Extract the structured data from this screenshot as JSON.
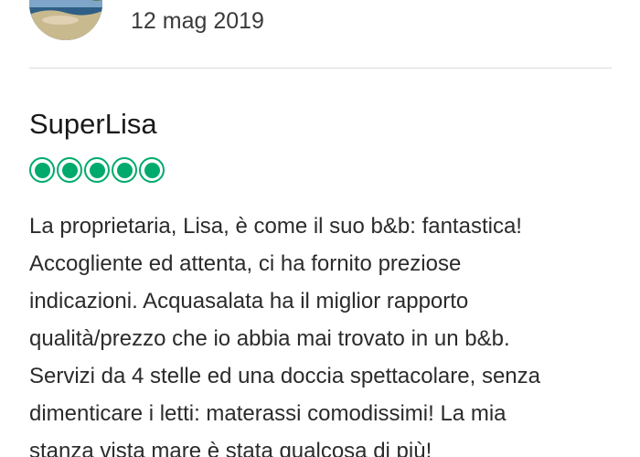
{
  "previous_review": {
    "date": "12 mag 2019",
    "avatar_icon": "profile-photo-beach"
  },
  "review": {
    "reviewer": "SuperLisa",
    "rating": {
      "value": 5,
      "max": 5,
      "icon": "rating-bubble",
      "color": "#00aa6c"
    },
    "text_lines": [
      "La proprietaria, Lisa, è come il suo b&b: fantastica!",
      "Accogliente ed attenta, ci ha fornito preziose",
      "indicazioni. Acquasalata ha il miglior rapporto",
      "qualità/prezzo che io abbia mai trovato in un b&b.",
      "Servizi da 4 stelle ed una doccia spettacolare, senza",
      "dimenticare i letti: materassi comodissimi! La mia",
      "stanza vista mare è stata qualcosa di più!"
    ]
  }
}
